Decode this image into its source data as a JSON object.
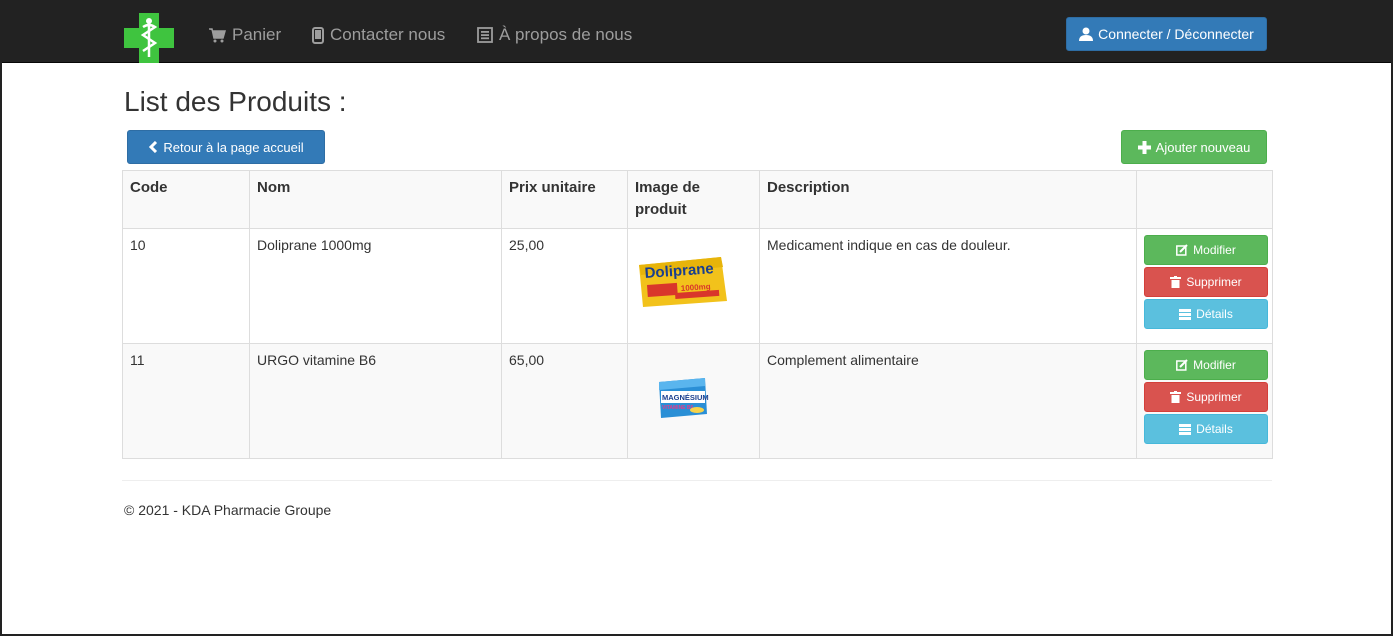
{
  "nav": {
    "items": [
      {
        "label": "Panier",
        "icon": "shopping-cart-icon"
      },
      {
        "label": "Contacter nous",
        "icon": "phone-icon"
      },
      {
        "label": "À propos de nous",
        "icon": "list-alt-icon"
      }
    ],
    "login_label": "Connecter / Déconnecter"
  },
  "page": {
    "title": "List des Produits :",
    "back_label": "Retour à la page accueil",
    "add_label": "Ajouter nouveau"
  },
  "table": {
    "headers": [
      "Code",
      "Nom",
      "Prix unitaire",
      "Image de produit",
      "Description",
      ""
    ],
    "rows": [
      {
        "code": "10",
        "nom": "Doliprane 1000mg",
        "prix": "25,00",
        "image_text": "Doliprane",
        "image_sub": "1000mg",
        "description": "Medicament indique en cas de douleur."
      },
      {
        "code": "11",
        "nom": "URGO vitamine B6",
        "prix": "65,00",
        "image_text": "MAGNÉSIUM",
        "image_sub": "VITAMINE B6",
        "description": "Complement alimentaire"
      }
    ],
    "actions": {
      "edit": "Modifier",
      "delete": "Supprimer",
      "details": "Détails"
    }
  },
  "footer": {
    "text": "© 2021 - KDA Pharmacie Groupe"
  },
  "colors": {
    "navbar": "#222222",
    "primary": "#337ab7",
    "success": "#5cb85c",
    "danger": "#d9534f",
    "info": "#5bc0de",
    "logo_green": "#3fc43f"
  }
}
